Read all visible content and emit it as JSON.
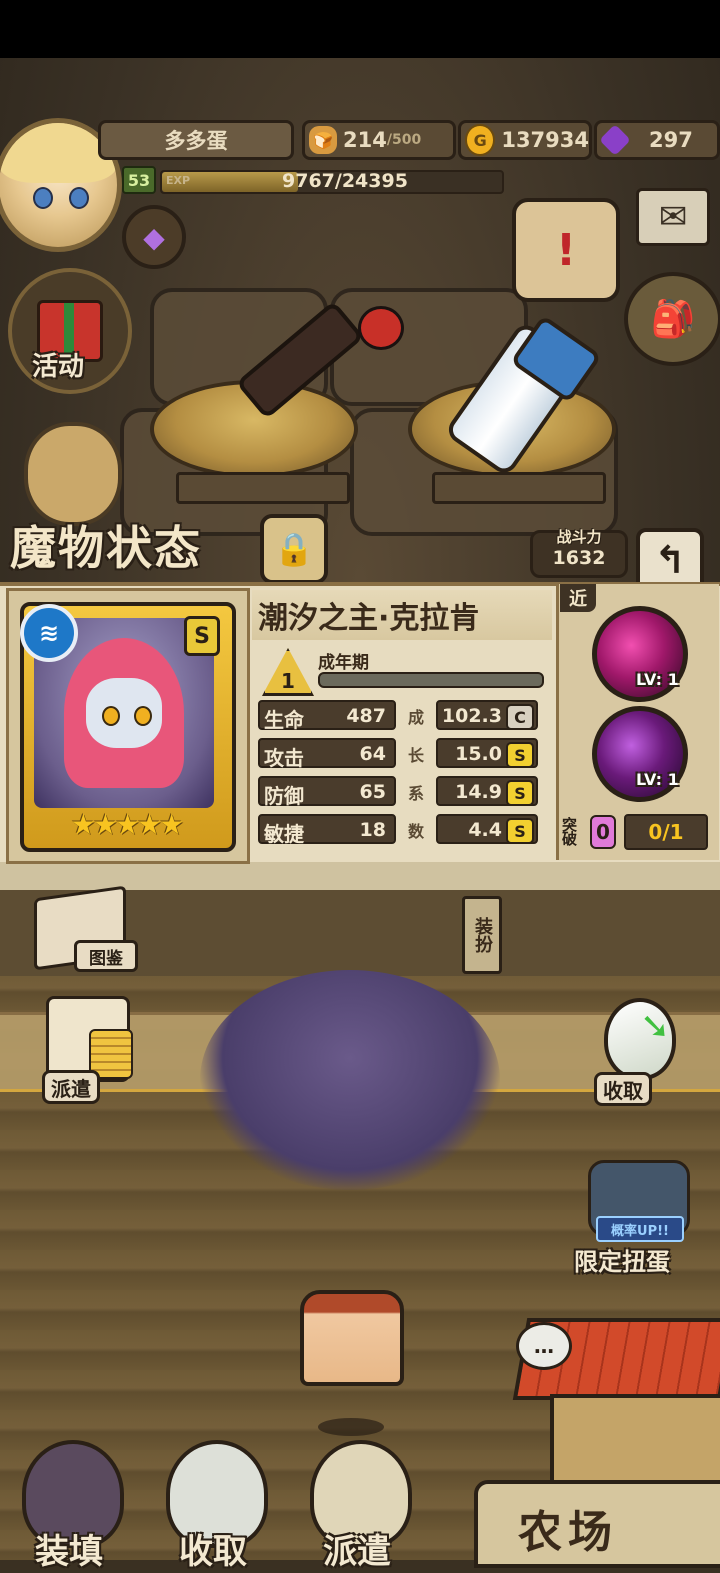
{
  "header": {
    "player_name": "多多蛋",
    "level": "53",
    "exp_label": "EXP",
    "exp_text": "9767/24395",
    "exp_progress": 0.4,
    "bread_value": "214",
    "bread_max": "/500",
    "gold_value": "137934",
    "gem_value": "297"
  },
  "side_buttons": {
    "event_label": "活动"
  },
  "status_title": "魔物状态",
  "power": {
    "label": "战斗力",
    "value": "1632"
  },
  "monster": {
    "name": "潮汐之主·克拉肯",
    "rank": "S",
    "element_glyph": "≋",
    "stars": 5,
    "stage_number": "1",
    "stage_label": "成年期",
    "stats": [
      {
        "name": "生命",
        "value": "487",
        "growth_char": "成",
        "growth": "102.3",
        "grade": "C"
      },
      {
        "name": "攻击",
        "value": "64",
        "growth_char": "长",
        "growth": "15.0",
        "grade": "S"
      },
      {
        "name": "防御",
        "value": "65",
        "growth_char": "系",
        "growth": "14.9",
        "grade": "S"
      },
      {
        "name": "敏捷",
        "value": "18",
        "growth_char": "数",
        "growth": "4.4",
        "grade": "S"
      }
    ]
  },
  "skills": {
    "range_label": "近",
    "items": [
      {
        "level": "LV: 1"
      },
      {
        "level": "LV: 1"
      }
    ],
    "break_label": "突破",
    "break_value": "0",
    "break_progress": "0/1"
  },
  "panel_buttons": {
    "book_label": "图鉴",
    "equip_label": "装扮"
  },
  "farm_buttons": {
    "dispatch_label": "派遣",
    "collect_label": "收取",
    "gacha_up": "概率UP!!",
    "gacha_label": "限定扭蛋"
  },
  "bottom_nav": {
    "load_label": "装填",
    "collect_label": "收取",
    "dispatch_label": "派遣",
    "farm_label": "农场"
  },
  "colors": {
    "grade_c": "#d8d0c0",
    "grade_s": "#f2d030",
    "accent_gold": "#f8c420"
  }
}
